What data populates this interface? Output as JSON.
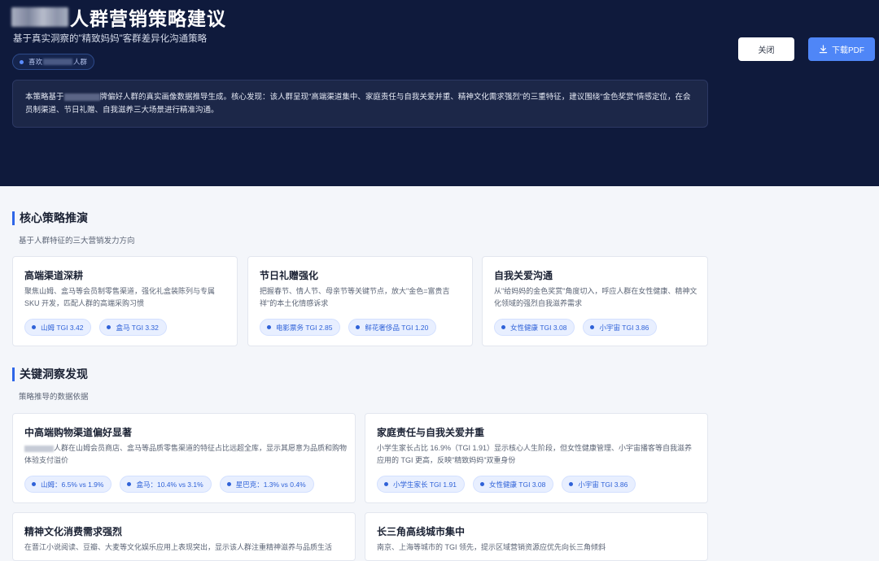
{
  "header": {
    "title": "人群营销策略建议",
    "subtitle": "基于真实洞察的\"精致妈妈\"客群差异化沟通策略",
    "tag": {
      "prefix": "喜欢",
      "suffix": "人群"
    },
    "summary": {
      "prefix": "本策略基于",
      "rest": "牌偏好人群的真实画像数据推导生成。核心发现：该人群呈现\"高端渠道集中、家庭责任与自我关爱并重、精神文化需求强烈\"的三重特征，建议围绕\"金色奖赏\"情感定位，在会员制渠道、节日礼赠、自我滋养三大场景进行精准沟通。"
    },
    "buttons": {
      "close": "关闭",
      "download": "下载PDF"
    }
  },
  "strategy": {
    "title": "核心策略推演",
    "subtitle": "基于人群特征的三大营销发力方向",
    "cards": [
      {
        "title": "高端渠道深耕",
        "desc": "聚焦山姆、盒马等会员制零售渠道，强化礼盒装陈列与专属 SKU 开发，匹配人群的高端采购习惯",
        "chips": [
          "山姆 TGI 3.42",
          "盒马 TGI 3.32"
        ]
      },
      {
        "title": "节日礼赠强化",
        "desc": "把握春节、情人节、母亲节等关键节点，放大\"金色=富贵吉祥\"的本土化情感诉求",
        "chips": [
          "电影票务 TGI 2.85",
          "鲜花奢侈品 TGI 1.20"
        ]
      },
      {
        "title": "自我关爱沟通",
        "desc": "从\"给妈妈的金色奖赏\"角度切入，呼应人群在女性健康、精神文化领域的强烈自我滋养需求",
        "chips": [
          "女性健康 TGI 3.08",
          "小宇宙 TGI 3.86"
        ]
      }
    ]
  },
  "insights": {
    "title": "关键洞察发现",
    "subtitle": "策略推导的数据依据",
    "cards": [
      {
        "title": "中高端购物渠道偏好显著",
        "desc": "人群在山姆会员商店、盒马等品质零售渠道的特征占比远超全库，显示其愿意为品质和购物体验支付溢价",
        "chips": [
          "山姆：6.5% vs 1.9%",
          "盒马：10.4% vs 3.1%",
          "星巴克：1.3% vs 0.4%"
        ]
      },
      {
        "title": "家庭责任与自我关爱并重",
        "desc": "小学生家长占比 16.9%（TGI 1.91）显示核心人生阶段，但女性健康管理、小宇宙播客等自我滋养应用的 TGI 更高，反映\"精致妈妈\"双重身份",
        "chips": [
          "小学生家长 TGI 1.91",
          "女性健康 TGI 3.08",
          "小宇宙 TGI 3.86"
        ]
      },
      {
        "title": "精神文化消费需求强烈",
        "desc": "在晋江小说阅读、豆瓣、大麦等文化娱乐应用上表现突出，显示该人群注重精神滋养与品质生活"
      },
      {
        "title": "长三角高线城市集中",
        "desc": "南京、上海等城市的 TGI 领先，提示区域营销资源应优先向长三角倾斜"
      }
    ]
  }
}
